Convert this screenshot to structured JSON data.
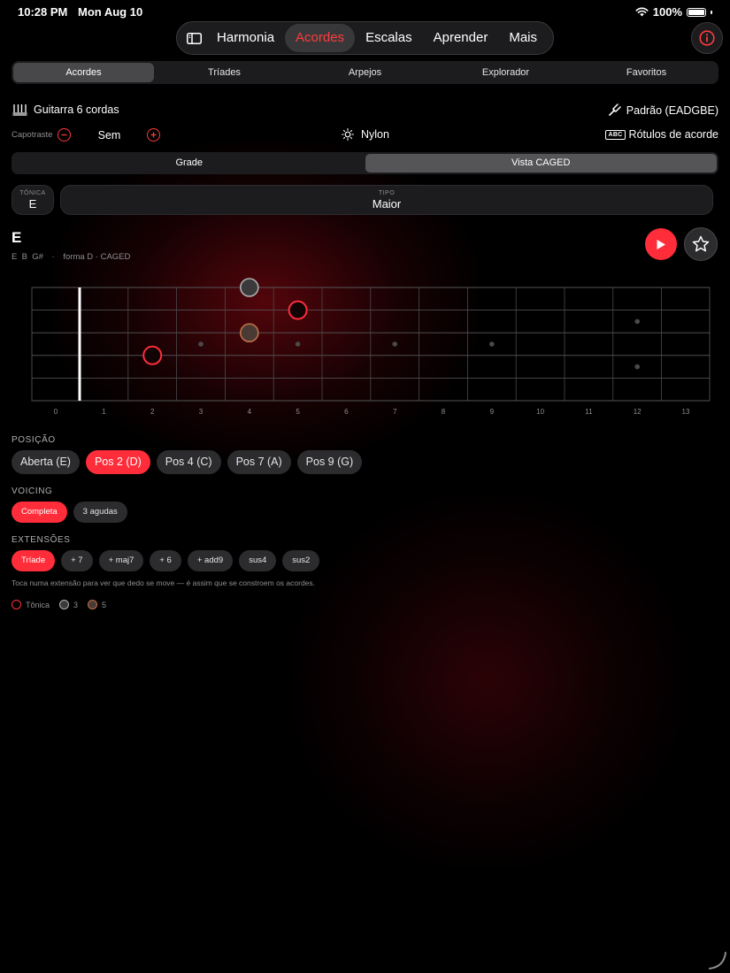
{
  "status_bar": {
    "time": "10:28 PM",
    "date": "Mon Aug 10",
    "battery": "100%"
  },
  "top_nav": {
    "tabs": [
      {
        "label": "Harmonia",
        "active": false
      },
      {
        "label": "Acordes",
        "active": true
      },
      {
        "label": "Escalas",
        "active": false
      },
      {
        "label": "Aprender",
        "active": false
      },
      {
        "label": "Mais",
        "active": false
      }
    ]
  },
  "sub_tabs": [
    {
      "label": "Acordes",
      "active": true
    },
    {
      "label": "Tríades",
      "active": false
    },
    {
      "label": "Arpejos",
      "active": false
    },
    {
      "label": "Explorador",
      "active": false
    },
    {
      "label": "Favoritos",
      "active": false
    }
  ],
  "instrument": {
    "name": "Guitarra 6 cordas",
    "tuning": "Padrão (EADGBE)"
  },
  "capo": {
    "label": "Capotraste",
    "value": "Sem"
  },
  "strings": {
    "type": "Nylon"
  },
  "chord_labels": {
    "badge": "ABC",
    "label": "Rótulos de acorde"
  },
  "view_toggle": [
    {
      "label": "Grade",
      "active": false
    },
    {
      "label": "Vista CAGED",
      "active": true
    }
  ],
  "tonic": {
    "label": "TÔNICA",
    "value": "E"
  },
  "chord_type": {
    "label": "TIPO",
    "value": "Maior"
  },
  "chord": {
    "name": "E",
    "notes": "E  B  G#",
    "separator": "·",
    "shape": "forma D · CAGED"
  },
  "fretboard": {
    "fret_numbers": [
      "0",
      "1",
      "2",
      "3",
      "4",
      "5",
      "6",
      "7",
      "8",
      "9",
      "10",
      "11",
      "12",
      "13"
    ],
    "inlay_frets": [
      3,
      5,
      7,
      9
    ],
    "double_inlay_fret": 12,
    "notes": [
      {
        "string": 1,
        "fret": 4,
        "role": "3"
      },
      {
        "string": 2,
        "fret": 5,
        "role": "root"
      },
      {
        "string": 3,
        "fret": 4,
        "role": "5"
      },
      {
        "string": 4,
        "fret": 2,
        "role": "root"
      }
    ]
  },
  "position": {
    "label": "POSIÇÃO",
    "options": [
      {
        "label": "Aberta (E)",
        "active": false
      },
      {
        "label": "Pos 2 (D)",
        "active": true
      },
      {
        "label": "Pos 4 (C)",
        "active": false
      },
      {
        "label": "Pos 7 (A)",
        "active": false
      },
      {
        "label": "Pos 9 (G)",
        "active": false
      }
    ]
  },
  "voicing": {
    "label": "VOICING",
    "options": [
      {
        "label": "Completa",
        "active": true
      },
      {
        "label": "3 agudas",
        "active": false
      }
    ]
  },
  "extensions": {
    "label": "EXTENSÕES",
    "options": [
      {
        "label": "Tríade",
        "active": true
      },
      {
        "label": "+ 7",
        "active": false
      },
      {
        "label": "+ maj7",
        "active": false
      },
      {
        "label": "+ 6",
        "active": false
      },
      {
        "label": "+ add9",
        "active": false
      },
      {
        "label": "sus4",
        "active": false
      },
      {
        "label": "sus2",
        "active": false
      }
    ],
    "hint": "Toca numa extensão para ver que dedo se move — é assim que se constroem os acordes."
  },
  "legend": [
    {
      "label": "Tônica",
      "role": "root"
    },
    {
      "label": "3",
      "role": "3"
    },
    {
      "label": "5",
      "role": "5"
    }
  ],
  "colors": {
    "accent": "#ff2d3a",
    "root_ring": "#ff2d3a",
    "third_fill": "#3a3a3c",
    "third_ring": "#b0b0b0",
    "fifth_fill": "#4a3a34",
    "fifth_ring": "#c0704a"
  }
}
